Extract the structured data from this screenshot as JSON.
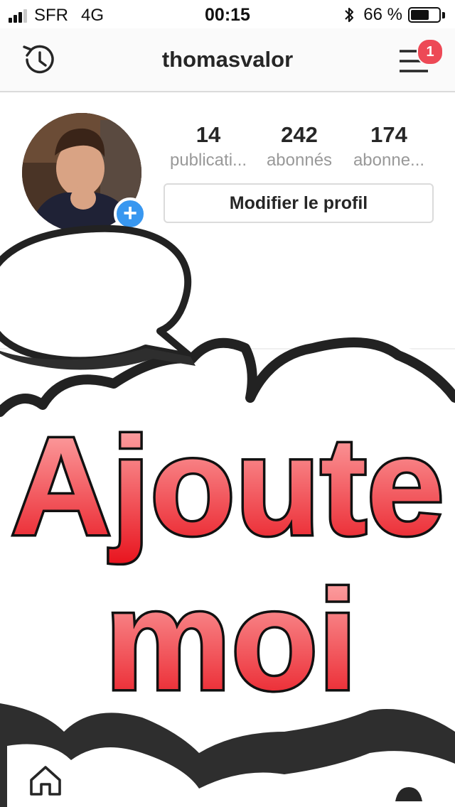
{
  "status_bar": {
    "carrier": "SFR",
    "network": "4G",
    "time": "00:15",
    "battery_percent": "66 %",
    "battery_level": 0.66,
    "signal_bars_active": 3,
    "signal_bars_total": 4
  },
  "header": {
    "username": "thomasvalor",
    "notification_count": "1",
    "history_icon": "history-icon",
    "menu_icon": "hamburger-menu-icon"
  },
  "profile": {
    "stats": [
      {
        "value": "14",
        "label": "publicati..."
      },
      {
        "value": "242",
        "label": "abonnés"
      },
      {
        "value": "174",
        "label": "abonne..."
      }
    ],
    "edit_button_label": "Modifier le profil",
    "add_story_glyph": "+"
  },
  "overlay": {
    "line1": "Ajoute",
    "line2": "moi"
  },
  "tab_bar": {
    "home_icon": "home-icon",
    "profile_icon": "profile-tab-icon"
  },
  "colors": {
    "badge": "#ed4956",
    "add_story": "#3897f0",
    "text_fill_top": "#ffb4b4",
    "text_fill_bottom": "#e8141e",
    "cloud_stroke": "#222222"
  }
}
